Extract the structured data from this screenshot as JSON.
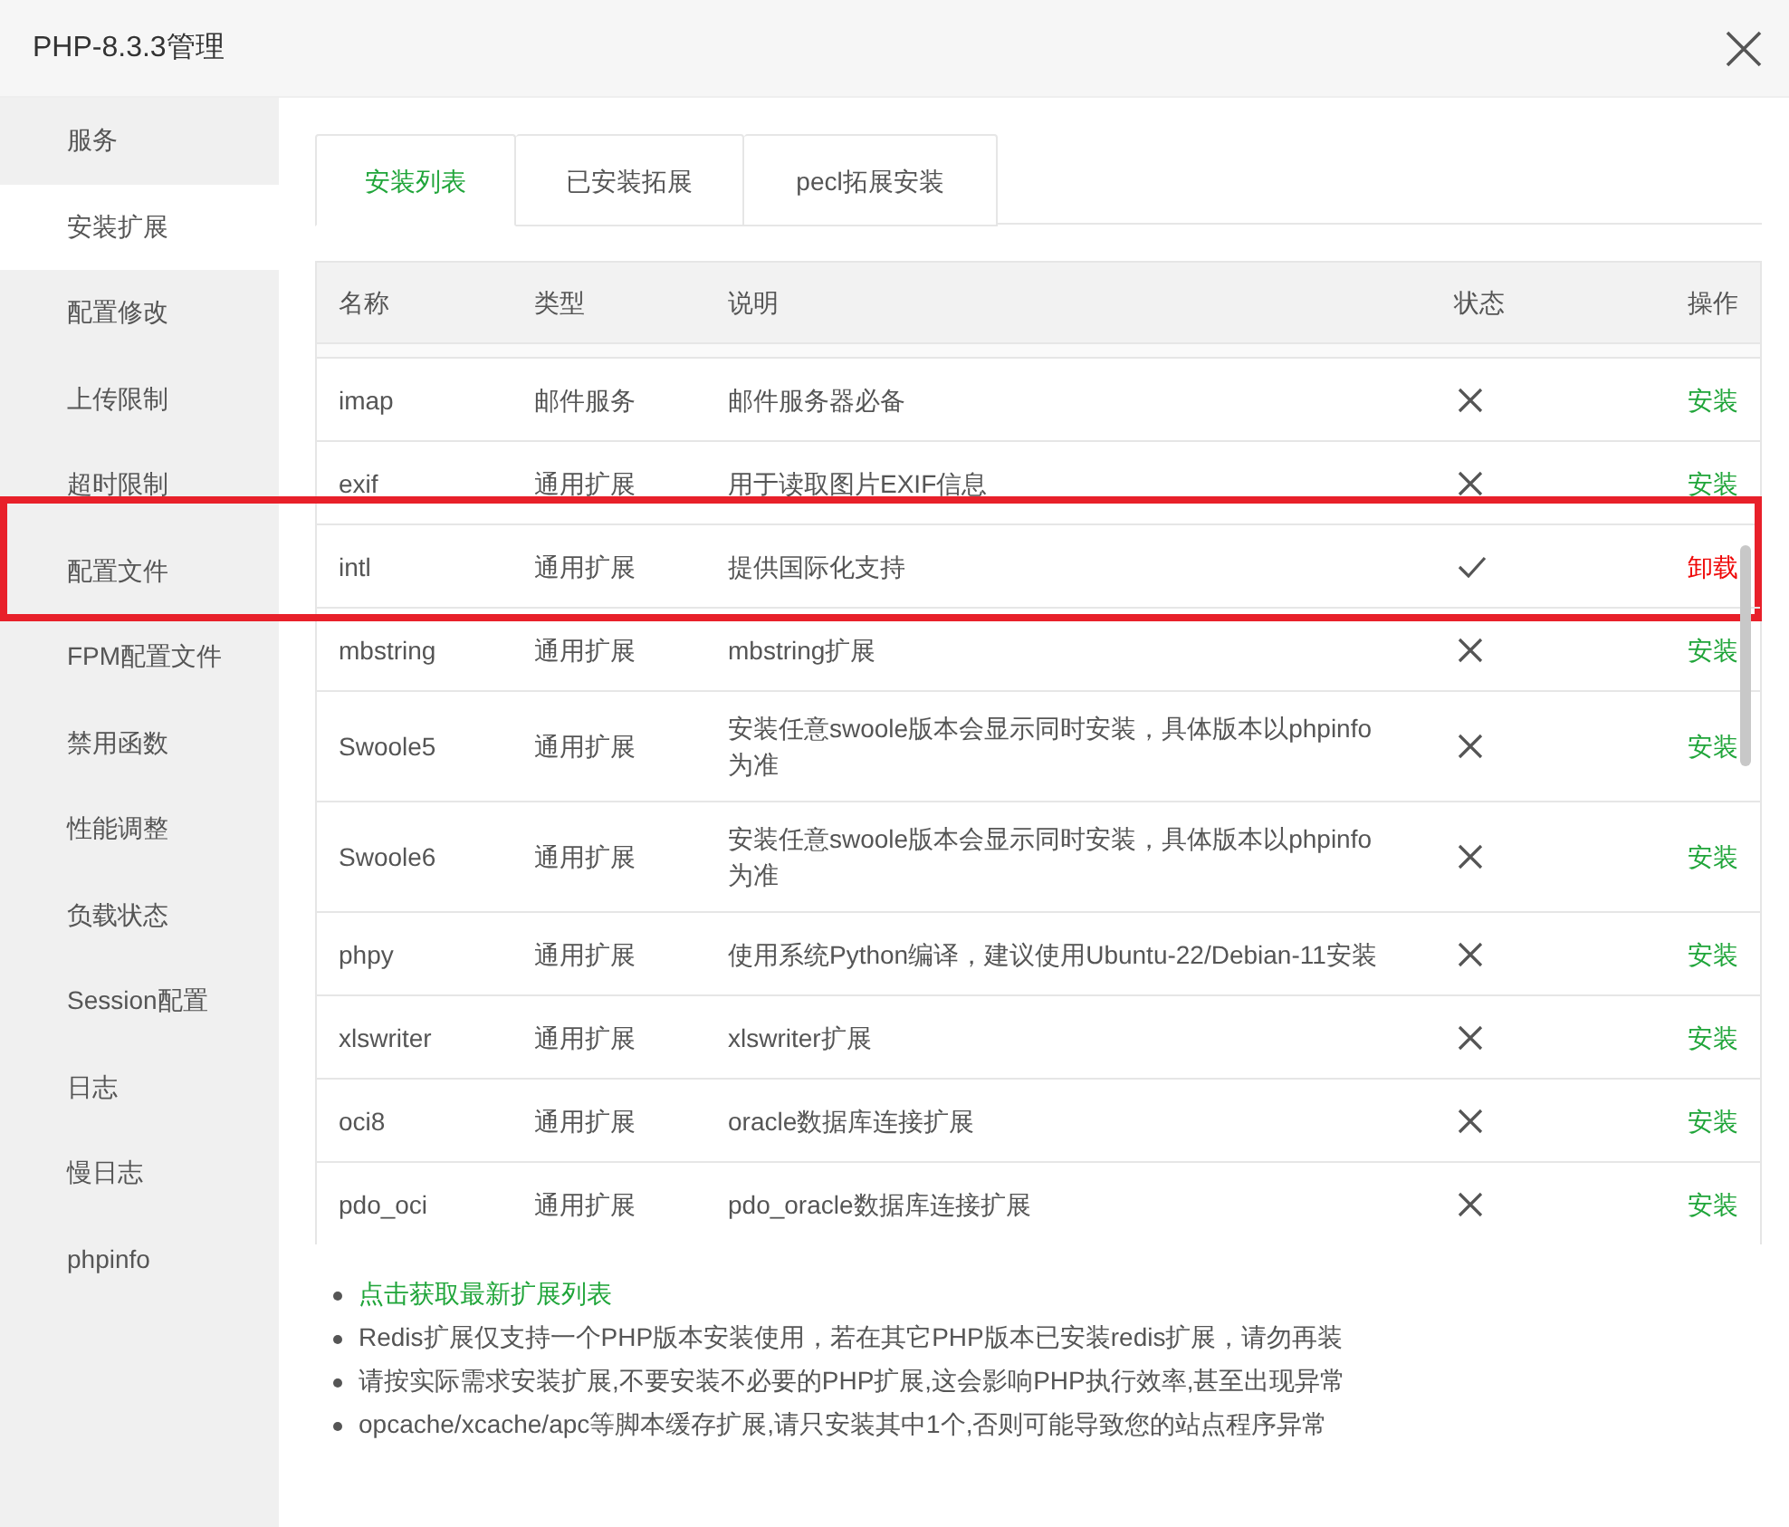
{
  "window": {
    "title": "PHP-8.3.3管理"
  },
  "sidebar": {
    "items": [
      {
        "label": "服务",
        "selected": false
      },
      {
        "label": "安装扩展",
        "selected": true
      },
      {
        "label": "配置修改",
        "selected": false
      },
      {
        "label": "上传限制",
        "selected": false
      },
      {
        "label": "超时限制",
        "selected": false
      },
      {
        "label": "配置文件",
        "selected": false
      },
      {
        "label": "FPM配置文件",
        "selected": false
      },
      {
        "label": "禁用函数",
        "selected": false
      },
      {
        "label": "性能调整",
        "selected": false
      },
      {
        "label": "负载状态",
        "selected": false
      },
      {
        "label": "Session配置",
        "selected": false
      },
      {
        "label": "日志",
        "selected": false
      },
      {
        "label": "慢日志",
        "selected": false
      },
      {
        "label": "phpinfo",
        "selected": false
      }
    ]
  },
  "tabs": [
    {
      "label": "安装列表",
      "selected": true
    },
    {
      "label": "已安装拓展",
      "selected": false
    },
    {
      "label": "pecl拓展安装",
      "selected": false
    }
  ],
  "table": {
    "columns": [
      "名称",
      "类型",
      "说明",
      "状态",
      "操作"
    ],
    "rows": [
      {
        "name": "imap",
        "type": "邮件服务",
        "description": "邮件服务器必备",
        "installed": false,
        "action": "安装",
        "highlighted": false
      },
      {
        "name": "exif",
        "type": "通用扩展",
        "description": "用于读取图片EXIF信息",
        "installed": false,
        "action": "安装",
        "highlighted": false
      },
      {
        "name": "intl",
        "type": "通用扩展",
        "description": "提供国际化支持",
        "installed": true,
        "action": "卸载",
        "highlighted": true
      },
      {
        "name": "mbstring",
        "type": "通用扩展",
        "description": "mbstring扩展",
        "installed": false,
        "action": "安装",
        "highlighted": false
      },
      {
        "name": "Swoole5",
        "type": "通用扩展",
        "description": "安装任意swoole版本会显示同时安装，具体版本以phpinfo为准",
        "installed": false,
        "action": "安装",
        "highlighted": false
      },
      {
        "name": "Swoole6",
        "type": "通用扩展",
        "description": "安装任意swoole版本会显示同时安装，具体版本以phpinfo为准",
        "installed": false,
        "action": "安装",
        "highlighted": false
      },
      {
        "name": "phpy",
        "type": "通用扩展",
        "description": "使用系统Python编译，建议使用Ubuntu-22/Debian-11安装",
        "installed": false,
        "action": "安装",
        "highlighted": false
      },
      {
        "name": "xlswriter",
        "type": "通用扩展",
        "description": "xlswriter扩展",
        "installed": false,
        "action": "安装",
        "highlighted": false
      },
      {
        "name": "oci8",
        "type": "通用扩展",
        "description": "oracle数据库连接扩展",
        "installed": false,
        "action": "安装",
        "highlighted": false
      },
      {
        "name": "pdo_oci",
        "type": "通用扩展",
        "description": "pdo_oracle数据库连接扩展",
        "installed": false,
        "action": "安装",
        "highlighted": false
      }
    ]
  },
  "notes": [
    {
      "kind": "link",
      "text": "点击获取最新扩展列表"
    },
    {
      "kind": "text",
      "text": "Redis扩展仅支持一个PHP版本安装使用，若在其它PHP版本已安装redis扩展，请勿再装"
    },
    {
      "kind": "text",
      "text": "请按实际需求安装扩展,不要安装不必要的PHP扩展,这会影响PHP执行效率,甚至出现异常"
    },
    {
      "kind": "text",
      "text": "opcache/xcache/apc等脚本缓存扩展,请只安装其中1个,否则可能导致您的站点程序异常"
    }
  ]
}
